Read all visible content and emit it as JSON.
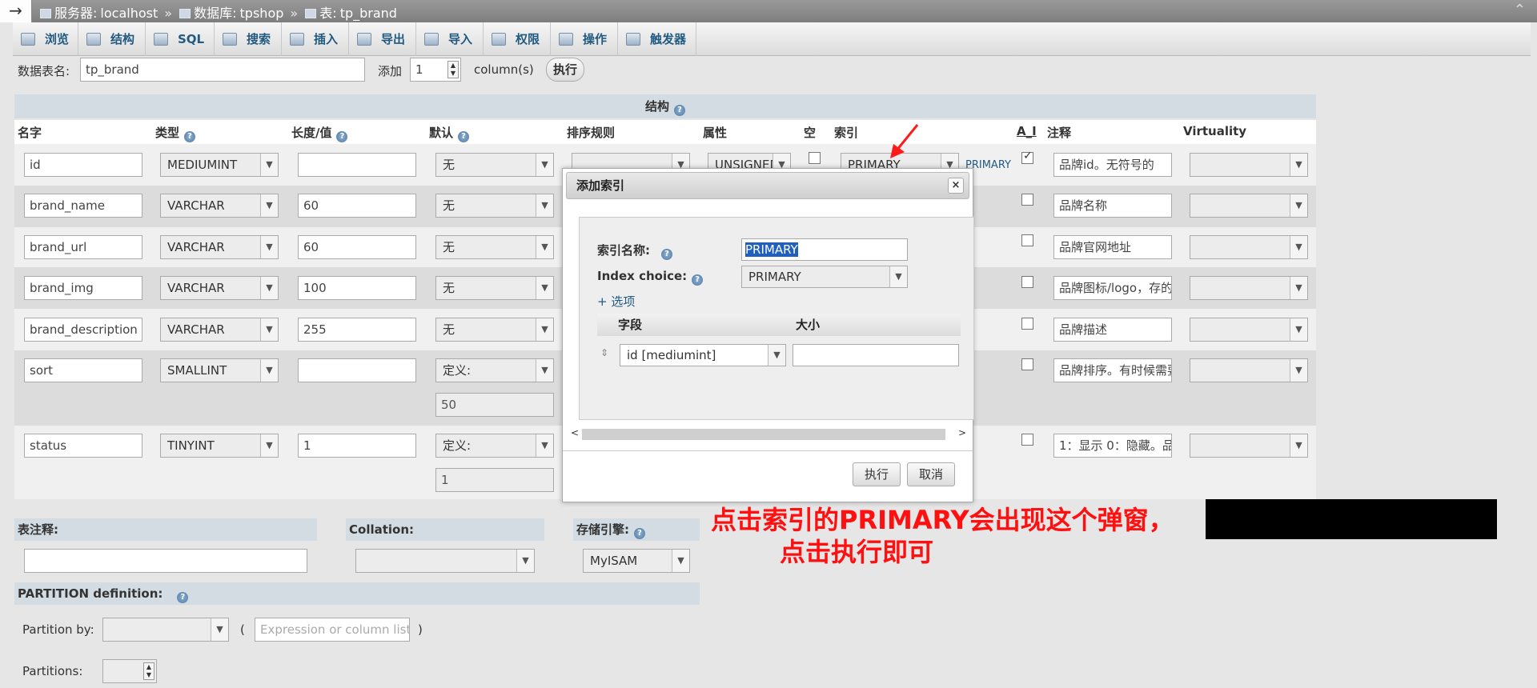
{
  "titlebar": {
    "arrow": "→",
    "server_label": "服务器:",
    "server": "localhost",
    "db_label": "数据库:",
    "db": "tpshop",
    "table_label": "表:",
    "table": "tp_brand",
    "sep": "»",
    "collapse": "⌃"
  },
  "tabs": [
    {
      "label": "浏览",
      "icon": "browse-icon"
    },
    {
      "label": "结构",
      "icon": "structure-icon"
    },
    {
      "label": "SQL",
      "icon": "sql-icon"
    },
    {
      "label": "搜索",
      "icon": "search-icon"
    },
    {
      "label": "插入",
      "icon": "insert-icon"
    },
    {
      "label": "导出",
      "icon": "export-icon"
    },
    {
      "label": "导入",
      "icon": "import-icon"
    },
    {
      "label": "权限",
      "icon": "privileges-icon"
    },
    {
      "label": "操作",
      "icon": "operations-icon"
    },
    {
      "label": "触发器",
      "icon": "triggers-icon"
    }
  ],
  "toprow": {
    "table_name_label": "数据表名:",
    "table_name": "tp_brand",
    "add_label": "添加",
    "add_count": "1",
    "columns_label": "column(s)",
    "execute": "执行"
  },
  "structure": {
    "title": "结构",
    "headers": {
      "name": "名字",
      "type": "类型",
      "length": "长度/值",
      "default": "默认",
      "collation": "排序规则",
      "attributes": "属性",
      "null": "空",
      "index": "索引",
      "ai": "A_I",
      "comment": "注释",
      "virtuality": "Virtuality"
    },
    "rows": [
      {
        "name": "id",
        "type": "MEDIUMINT",
        "length": "",
        "default": "无",
        "default_value": "",
        "attr": "UNSIGNED",
        "index": "PRIMARY",
        "index_tag": "PRIMARY",
        "ai": true,
        "comment": "品牌id。无符号的"
      },
      {
        "name": "brand_name",
        "type": "VARCHAR",
        "length": "60",
        "default": "无",
        "default_value": "",
        "ai": false,
        "comment": "品牌名称"
      },
      {
        "name": "brand_url",
        "type": "VARCHAR",
        "length": "60",
        "default": "无",
        "default_value": "",
        "ai": false,
        "comment": "品牌官网地址"
      },
      {
        "name": "brand_img",
        "type": "VARCHAR",
        "length": "100",
        "default": "无",
        "default_value": "",
        "ai": false,
        "comment": "品牌图标/logo，存的是"
      },
      {
        "name": "brand_description",
        "type": "VARCHAR",
        "length": "255",
        "default": "无",
        "default_value": "",
        "ai": false,
        "comment": "品牌描述"
      },
      {
        "name": "sort",
        "type": "SMALLINT",
        "length": "",
        "default": "定义:",
        "default_value": "50",
        "ai": false,
        "comment": "品牌排序。有时候需要"
      },
      {
        "name": "status",
        "type": "TINYINT",
        "length": "1",
        "default": "定义:",
        "default_value": "1",
        "ai": false,
        "comment": "1：显示 0：隐藏。品"
      }
    ]
  },
  "bottom": {
    "table_comment_label": "表注释:",
    "collation_label": "Collation:",
    "engine_label": "存储引擎:",
    "engine": "MyISAM",
    "partition_label": "PARTITION definition:",
    "partition_by_label": "Partition by:",
    "open_paren": "(",
    "close_paren": ")",
    "expression_placeholder": "Expression or column list",
    "partitions_label": "Partitions:"
  },
  "modal": {
    "title": "添加索引",
    "close": "×",
    "index_name_label": "索引名称:",
    "index_name": "PRIMARY",
    "index_choice_label": "Index choice:",
    "index_choice": "PRIMARY",
    "options_link": "+ 选项",
    "field_header": "字段",
    "size_header": "大小",
    "field_value": "id [mediumint]",
    "left_arrow": "<",
    "right_arrow": ">",
    "execute": "执行",
    "cancel": "取消"
  },
  "annotation": {
    "line1": "点击索引的PRIMARY会出现这个弹窗，",
    "line2": "点击执行即可",
    "color": "#ff1010"
  }
}
